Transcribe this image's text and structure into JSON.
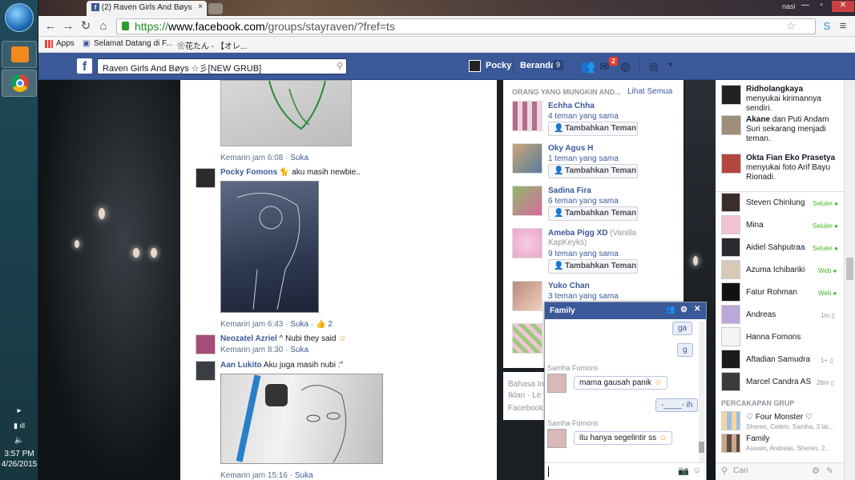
{
  "os": {
    "time": "3:57 PM",
    "date": "4/26/2015"
  },
  "browser": {
    "tab_title": "(2) Raven Girls And Bøys",
    "user": "nasi",
    "url_green": "https://",
    "url_domain": "www.facebook.com",
    "url_path": "/groups/stayraven/?fref=ts",
    "bookmarks": [
      "Apps",
      "Selamat Datang di F...",
      "❀花たん - 【オレ..."
    ]
  },
  "fb_header": {
    "logo": "f",
    "search_value": "Raven Girls And Bøys ☆彡[NEW GRUB]",
    "user_name": "Pocky",
    "home_label": "Beranda",
    "home_count": "9",
    "msg_count": "2"
  },
  "feed": {
    "post1_meta": {
      "time": "Kemarin jam 6:08",
      "sep": "·",
      "like": "Suka"
    },
    "comments": [
      {
        "author": "Pocky Fomons",
        "text": "aku masih newbie..",
        "time": "Kemarin jam 6:43",
        "sep": "·",
        "like": "Suka",
        "likes": "2"
      },
      {
        "author": "Neozatel Azriel",
        "text": "^ Nubi they said",
        "time": "Kemarin jam 8:30",
        "sep": "·",
        "like": "Suka"
      },
      {
        "author": "Aan Lukito",
        "text": "Aku juga masih nubi :\"",
        "time": "Kemarin jam 15:16",
        "sep": "·",
        "like": "Suka"
      }
    ]
  },
  "suggestions": {
    "header": "ORANG YANG MUNGKIN AND...",
    "see_all": "Lihat Semua",
    "add_label": "Tambahkan Teman",
    "people": [
      {
        "name": "Echha Chha",
        "mutual": "4 teman yang sama",
        "color": "#d8b3c4"
      },
      {
        "name": "Oky Agus H",
        "mutual": "1 teman yang sama",
        "color": "#c9a77a"
      },
      {
        "name": "Sadina Fira",
        "mutual": "6 teman yang sama",
        "color": "#8fb86a"
      },
      {
        "name": "Ameba Pigg XD",
        "extra": "(Vanilla KapKeyks)",
        "mutual": "9 teman yang sama",
        "color": "#e8b6d6"
      },
      {
        "name": "Yuko Chan",
        "mutual": "3 teman yang sama",
        "color": "#b88a7a"
      }
    ]
  },
  "footer": {
    "line1": "Bahasa In",
    "line2": "Iklan · Le",
    "line3": "Facebook"
  },
  "ticker": [
    {
      "actor": "Ridholangkaya",
      "text": "menyukai kirimannya sendiri."
    },
    {
      "actor": "Akane",
      "text": "dan Puti Andam Suri sekarang menjadi teman."
    },
    {
      "actor": "Okta Fian Eko Prasetya",
      "text": "menyukai foto Arif Bayu Rionadi."
    }
  ],
  "chat_contacts": [
    {
      "name": "Steven Chinlung",
      "status": "Seluler ●"
    },
    {
      "name": "Mina",
      "status": "Seluler ●"
    },
    {
      "name": "Aidiel Sahputraa",
      "status": "Seluler ●"
    },
    {
      "name": "Azuma Ichibariki",
      "status": "Web ●"
    },
    {
      "name": "Fatur Rohman",
      "status": "Web ●"
    },
    {
      "name": "Andreas",
      "time": "1m ▯"
    },
    {
      "name": "Hanna Fomons",
      "time": ""
    },
    {
      "name": "Aftadian Samudra",
      "time": "1+ ▯"
    },
    {
      "name": "Marcel Candra AS",
      "time": "26m ▯"
    }
  ],
  "group_chats": {
    "header": "PERCAKAPAN GRUP",
    "items": [
      {
        "name": "♡ Four Monster ♡",
        "members": "Sheren, Celem, Samha, 3 lai..."
      },
      {
        "name": "Family",
        "members": "Asswin, Andreas, Sheren, 2..."
      }
    ]
  },
  "chat_search_placeholder": "Cari",
  "chat_window": {
    "title": "Family",
    "messages": [
      {
        "text": "ga",
        "out": true
      },
      {
        "text": "g",
        "out": true
      },
      {
        "sender": "Samha Fomons",
        "text": "mama gausah panik"
      },
      {
        "text": "-____- ih",
        "out": true
      },
      {
        "sender": "Samha Fomons",
        "text": "itu hanya segelintir ss"
      }
    ]
  }
}
